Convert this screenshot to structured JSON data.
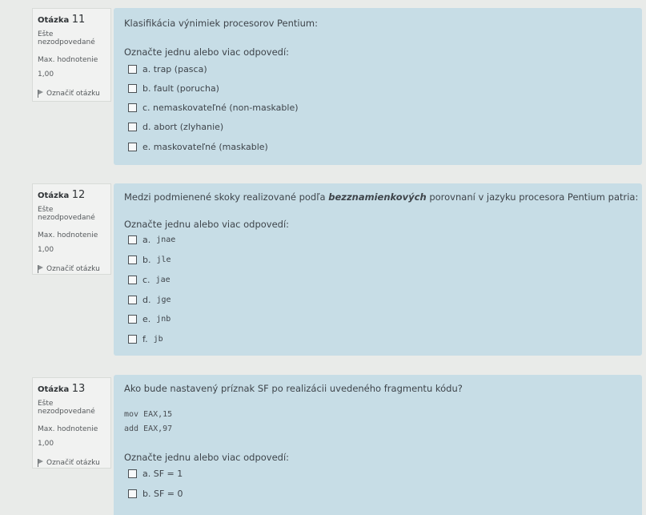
{
  "questions": [
    {
      "label": "Otázka",
      "number": "11",
      "status": "Ešte nezodpovedané",
      "max_label": "Max. hodnotenie",
      "max_value": "1,00",
      "flag_label": "Označiť otázku",
      "text": "Klasifikácia výnimiek procesorov Pentium:",
      "prompt": "Označte jednu alebo viac odpovedí:",
      "options": [
        "a. trap (pasca)",
        "b. fault (porucha)",
        "c. nemaskovateľné (non-maskable)",
        "d. abort (zlyhanie)",
        "e. maskovateľné (maskable)"
      ]
    },
    {
      "label": "Otázka",
      "number": "12",
      "status": "Ešte nezodpovedané",
      "max_label": "Max. hodnotenie",
      "max_value": "1,00",
      "flag_label": "Označiť otázku",
      "text_before": "Medzi podmienené skoky realizované podľa ",
      "text_em": "bezznamienkových",
      "text_after": " porovnaní v jazyku procesora Pentium patria:",
      "prompt": "Označte jednu alebo viac odpovedí:",
      "options": [
        {
          "letter": "a.",
          "code": "jnae"
        },
        {
          "letter": "b.",
          "code": "jle"
        },
        {
          "letter": "c.",
          "code": "jae"
        },
        {
          "letter": "d.",
          "code": "jge"
        },
        {
          "letter": "e.",
          "code": "jnb"
        },
        {
          "letter": "f.",
          "code": "jb"
        }
      ]
    },
    {
      "label": "Otázka",
      "number": "13",
      "status": "Ešte nezodpovedané",
      "max_label": "Max. hodnotenie",
      "max_value": "1,00",
      "flag_label": "Označiť otázku",
      "text": "Ako bude nastavený príznak SF po realizácii uvedeného fragmentu kódu?",
      "code": [
        "mov EAX,15",
        "add EAX,97"
      ],
      "prompt": "Označte jednu alebo viac odpovedí:",
      "options": [
        "a. SF = 1",
        "b. SF = 0"
      ]
    }
  ]
}
